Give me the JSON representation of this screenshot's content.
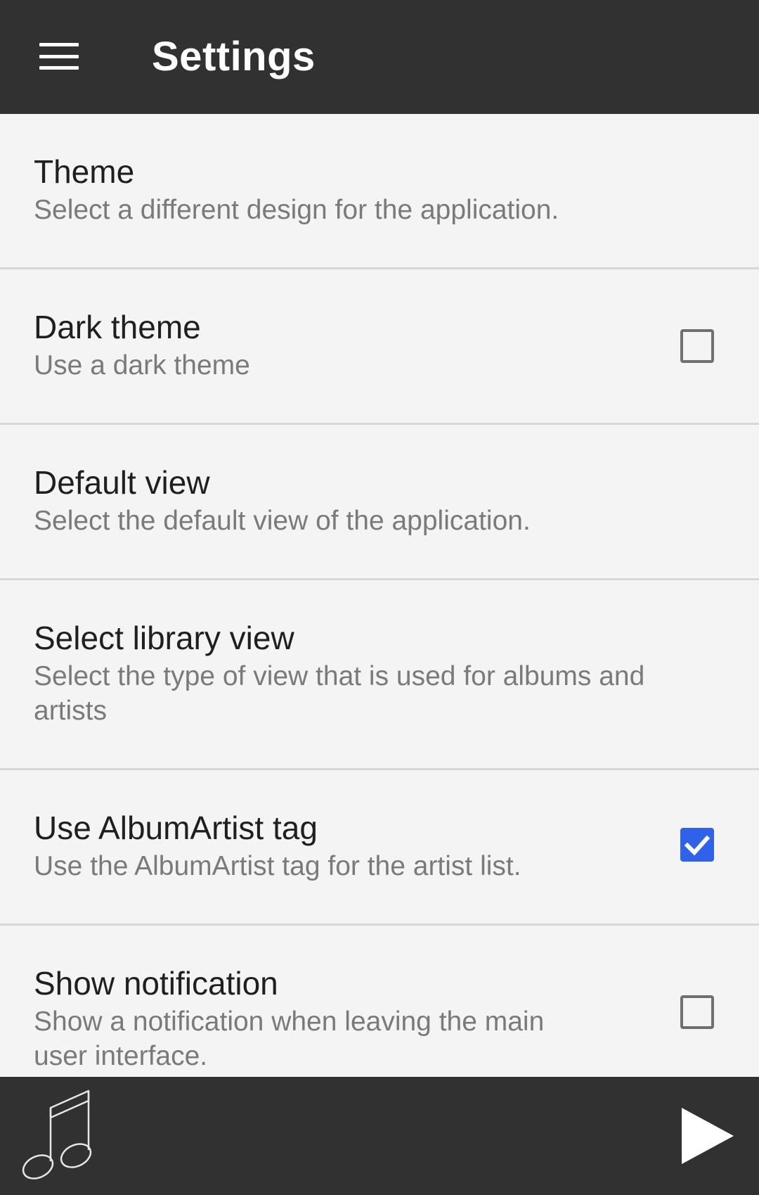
{
  "header": {
    "title": "Settings",
    "menu_icon": "hamburger-icon"
  },
  "settings": [
    {
      "title": "Theme",
      "description": "Select a different design for the application.",
      "has_checkbox": false
    },
    {
      "title": "Dark theme",
      "description": "Use a dark theme",
      "has_checkbox": true,
      "checked": false
    },
    {
      "title": "Default view",
      "description": "Select the default view of the application.",
      "has_checkbox": false
    },
    {
      "title": "Select library view",
      "description": "Select the type of view that is used for albums and artists",
      "has_checkbox": false
    },
    {
      "title": "Use AlbumArtist tag",
      "description": "Use the AlbumArtist tag for the artist list.",
      "has_checkbox": true,
      "checked": true
    },
    {
      "title": "Show notification",
      "description": "Show a notification when leaving the main user interface.",
      "has_checkbox": true,
      "checked": false
    }
  ],
  "player_bar": {
    "album_art_icon": "music-note-icon",
    "play_icon": "play-icon"
  },
  "colors": {
    "app_bar": "#313131",
    "background": "#f4f4f5",
    "accent": "#2f62e8",
    "title_text": "#1f1f1f",
    "description_text": "#7a7a7c",
    "divider": "#d7d7d9"
  }
}
